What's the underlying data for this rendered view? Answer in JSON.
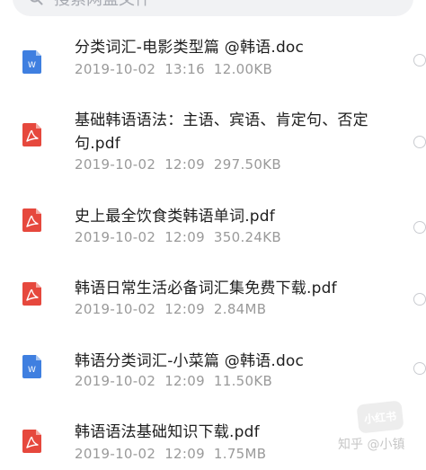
{
  "search": {
    "placeholder": "搜索网盘文件"
  },
  "files": [
    {
      "name": "分类词汇-电影类型篇 @韩语.doc",
      "date": "2019-10-02",
      "time": "13:16",
      "size": "12.00KB",
      "type": "doc"
    },
    {
      "name": "基础韩语语法：主语、宾语、肯定句、否定句.pdf",
      "date": "2019-10-02",
      "time": "12:09",
      "size": "297.50KB",
      "type": "pdf"
    },
    {
      "name": "史上最全饮食类韩语单词.pdf",
      "date": "2019-10-02",
      "time": "12:09",
      "size": "350.24KB",
      "type": "pdf"
    },
    {
      "name": "韩语日常生活必备词汇集免费下载.pdf",
      "date": "2019-10-02",
      "time": "12:09",
      "size": "2.84MB",
      "type": "pdf"
    },
    {
      "name": "韩语分类词汇-小菜篇 @韩语.doc",
      "date": "2019-10-02",
      "time": "12:09",
      "size": "11.50KB",
      "type": "doc"
    },
    {
      "name": "韩语语法基础知识下载.pdf",
      "date": "2019-10-02",
      "time": "12:09",
      "size": "1.75MB",
      "type": "pdf"
    }
  ],
  "icon_labels": {
    "doc": "W"
  },
  "colors": {
    "doc_icon": "#3f7fe0",
    "pdf_icon": "#e6483d"
  },
  "watermarks": {
    "badge": "小红书",
    "credit": "知乎 @小镇"
  }
}
